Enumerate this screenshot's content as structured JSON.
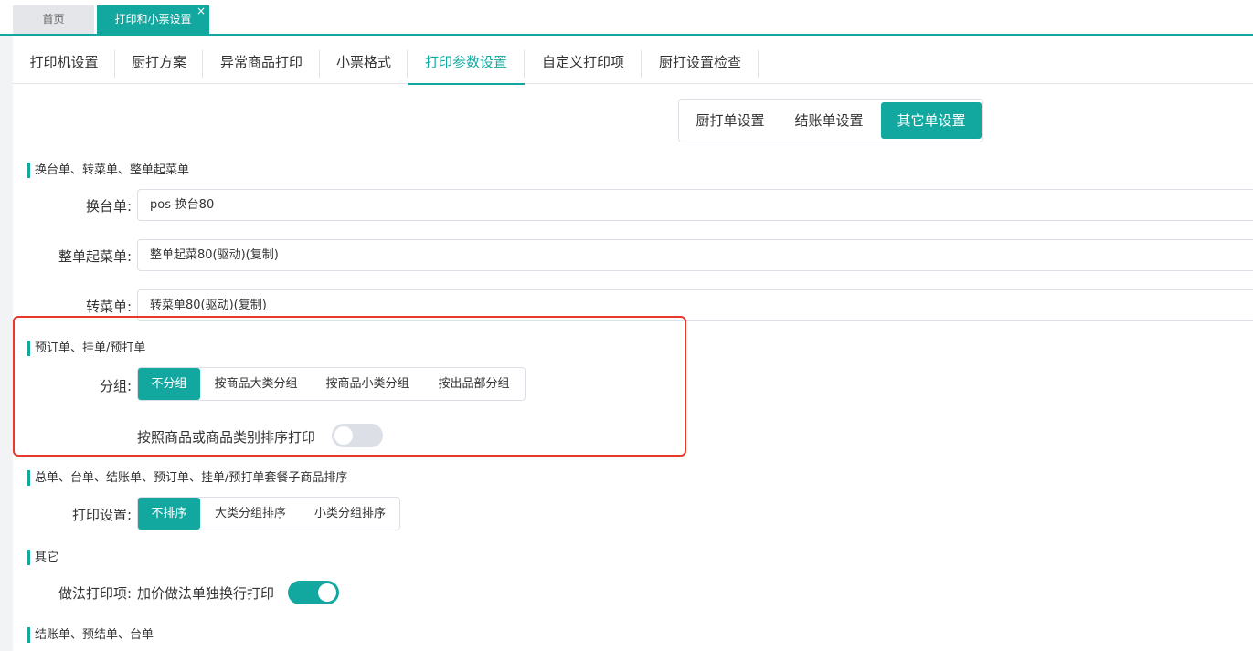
{
  "window_tabs": [
    {
      "label": "首页"
    },
    {
      "label": "打印和小票设置",
      "close": "×"
    }
  ],
  "sub_tabs": [
    {
      "label": "打印机设置"
    },
    {
      "label": "厨打方案"
    },
    {
      "label": "异常商品打印"
    },
    {
      "label": "小票格式"
    },
    {
      "label": "打印参数设置"
    },
    {
      "label": "自定义打印项"
    },
    {
      "label": "厨打设置检查"
    }
  ],
  "doc_type_switch": [
    "厨打单设置",
    "结账单设置",
    "其它单设置"
  ],
  "section1": {
    "title": "换台单、转菜单、整单起菜单",
    "fields": [
      {
        "label": "换台单:",
        "value": "pos-换台80"
      },
      {
        "label": "整单起菜单:",
        "value": "整单起菜80(驱动)(复制)"
      },
      {
        "label": "转菜单:",
        "value": "转菜单80(驱动)(复制)"
      }
    ]
  },
  "section2": {
    "title": "预订单、挂单/预打单",
    "group_label": "分组:",
    "group_options": [
      "不分组",
      "按商品大类分组",
      "按商品小类分组",
      "按出品部分组"
    ],
    "sort_label": "按照商品或商品类别排序打印",
    "sort_enabled": false
  },
  "section3": {
    "title": "总单、台单、结账单、预订单、挂单/预打单套餐子商品排序",
    "setting_label": "打印设置:",
    "options": [
      "不排序",
      "大类分组排序",
      "小类分组排序"
    ]
  },
  "section4": {
    "title": "其它",
    "method_label": "做法打印项:",
    "method_text": "加价做法单独换行打印",
    "method_enabled": true
  },
  "section5": {
    "title": "结账单、预结单、台单"
  },
  "colors": {
    "accent": "#12a8a0",
    "highlight": "#e8392c"
  }
}
